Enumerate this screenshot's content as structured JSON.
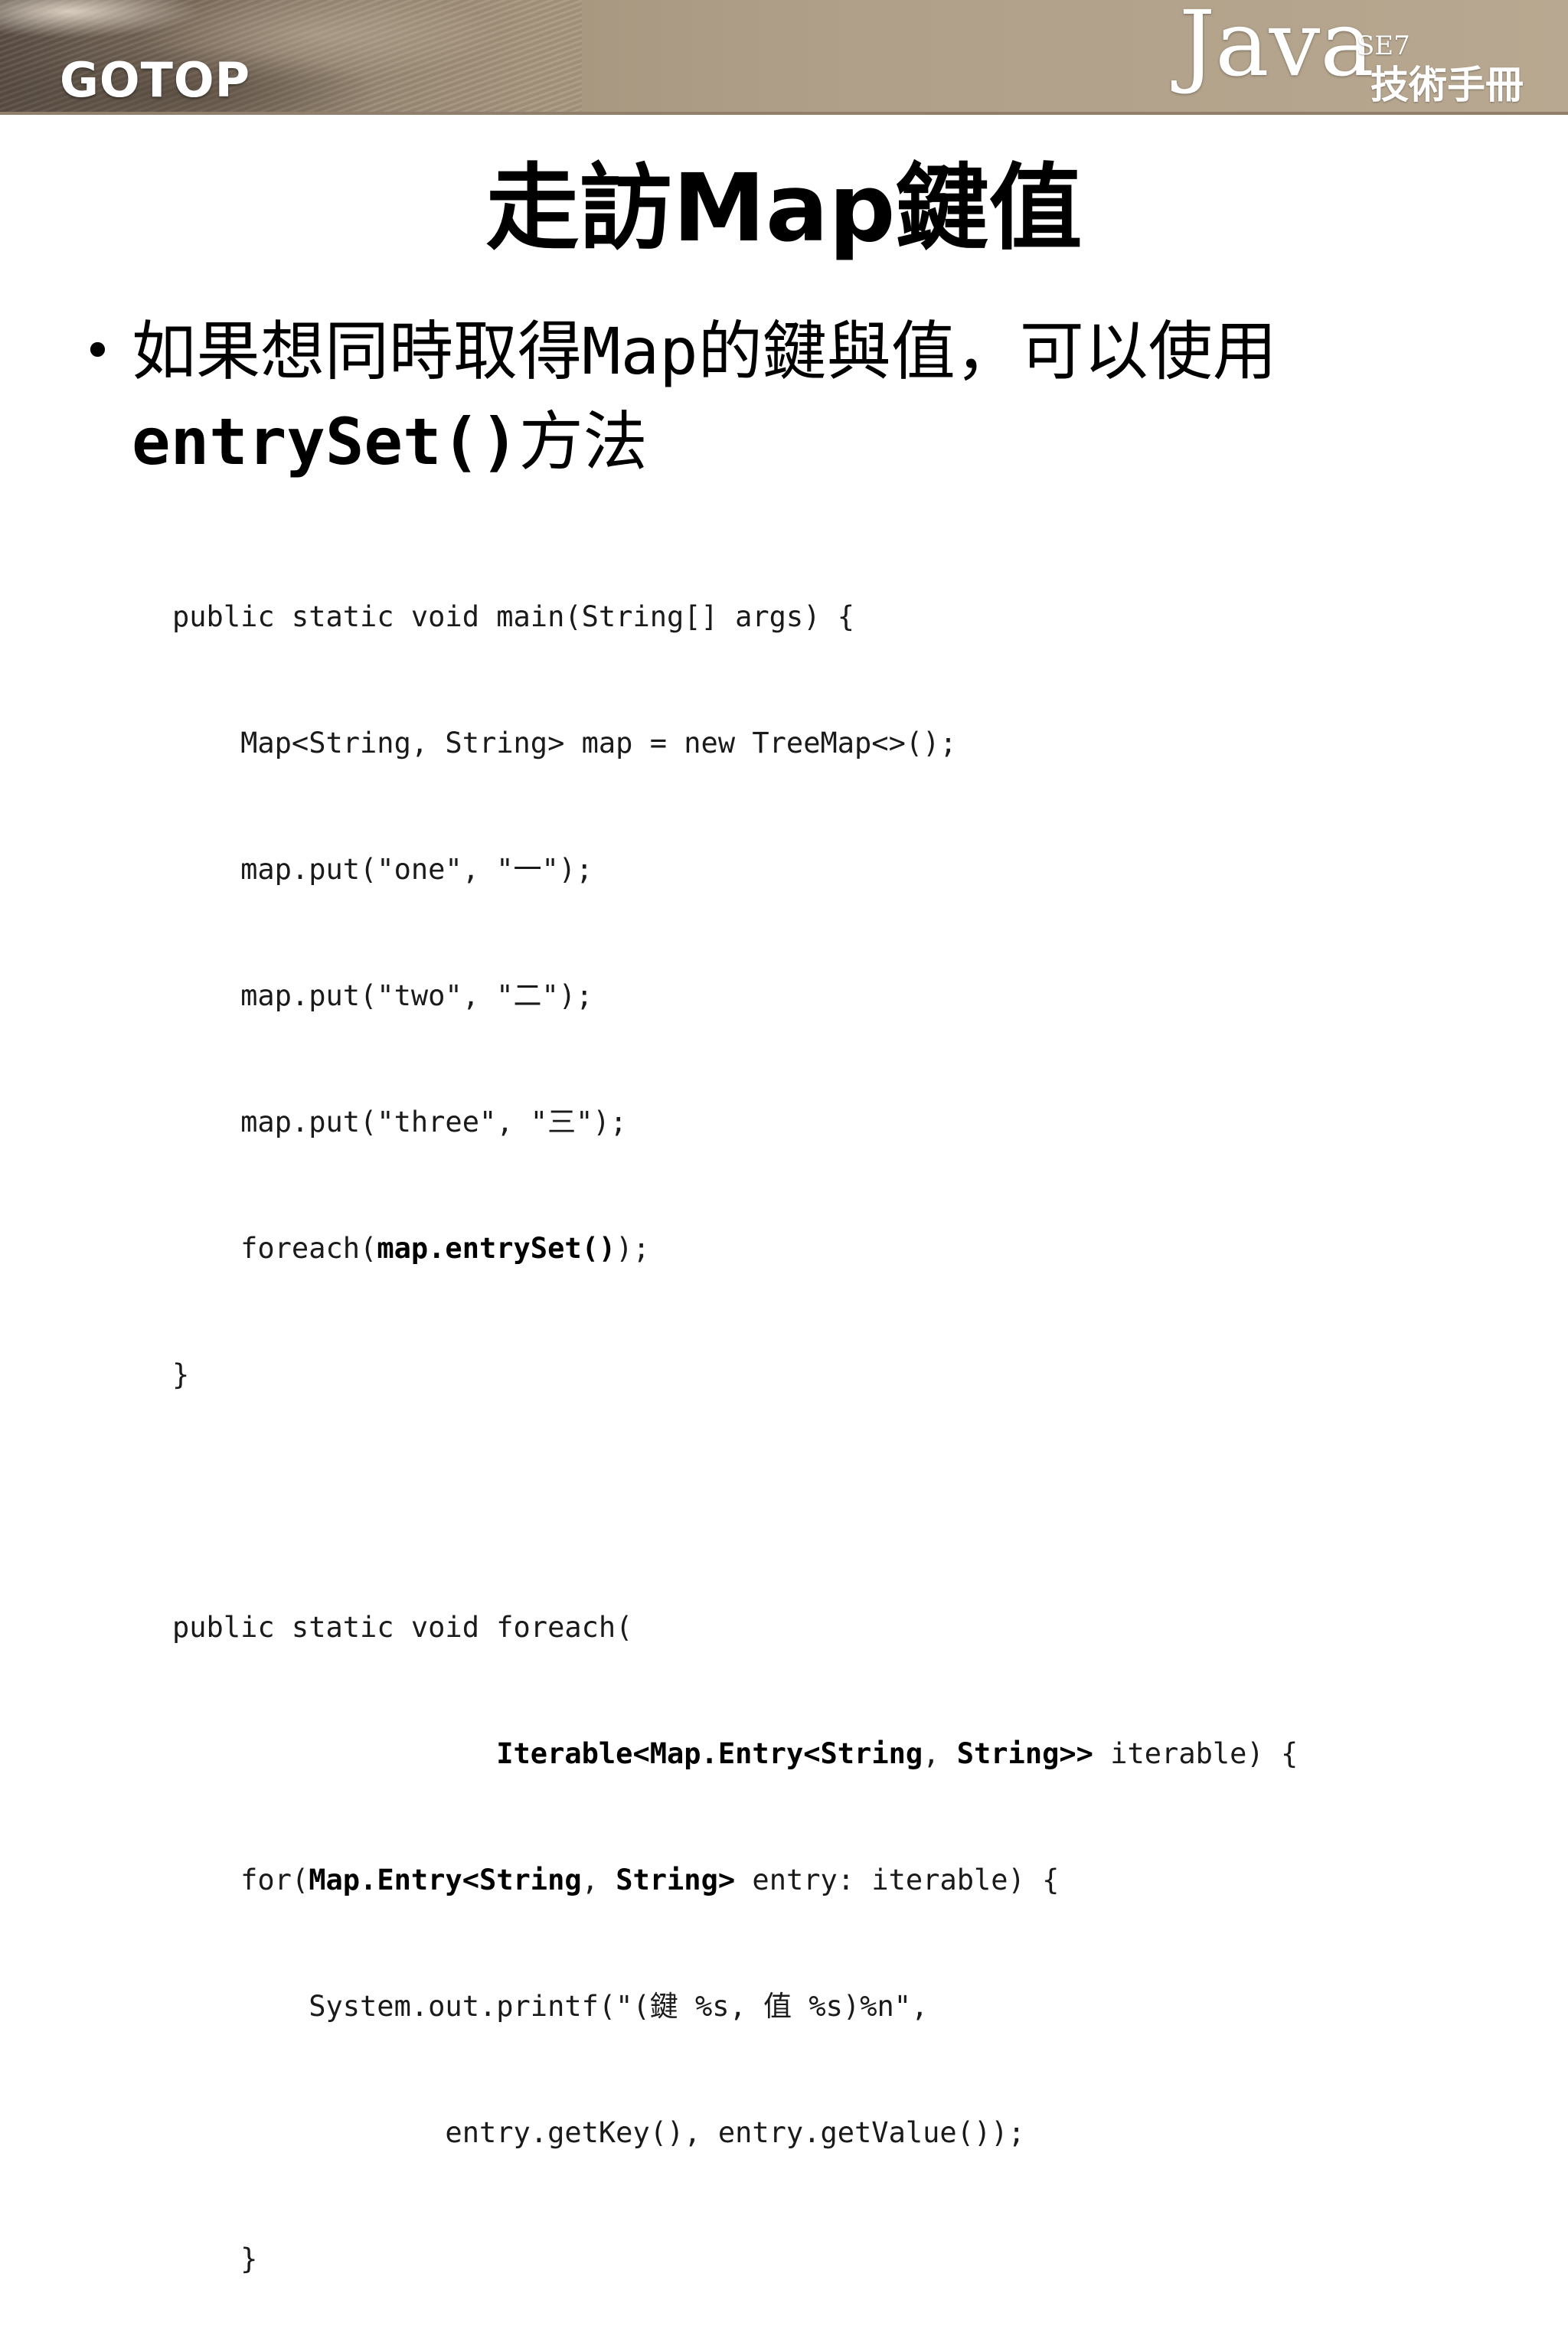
{
  "header": {
    "publisher_logo": "GOTOP",
    "book_logo": {
      "word": "Java",
      "edition": "SE7",
      "subtitle": "技術手冊"
    }
  },
  "slide": {
    "title": "走訪Map鍵值",
    "bullet": {
      "prefix": "如果想同時取得",
      "code_word": "Map",
      "middle": "的鍵與值，可以使用",
      "method": "entrySet()",
      "suffix": "方法"
    }
  },
  "code": {
    "l1": "public static void main(String[] args) {",
    "l2": "    Map<String, String> map = new TreeMap<>();",
    "l3": "    map.put(\"one\", \"一\");",
    "l4": "    map.put(\"two\", \"二\");",
    "l5": "    map.put(\"three\", \"三\");",
    "l6_pre": "    foreach(",
    "l6_bold": "map.entrySet()",
    "l6_post": ");",
    "l7": "}",
    "l8": "",
    "l9": "public static void foreach(",
    "l10_pre": "                   ",
    "l10_bold_a": "Iterable<Map.Entry<String",
    "l10_mid": ", ",
    "l10_bold_b": "String>>",
    "l10_post": " iterable) {",
    "l11_pre": "    for(",
    "l11_bold_a": "Map.Entry<String",
    "l11_mid": ", ",
    "l11_bold_b": "String>",
    "l11_post": " entry: iterable) {",
    "l12": "        System.out.printf(\"(鍵 %s, 值 %s)%n\",",
    "l13": "                entry.getKey(), entry.getValue());",
    "l14": "    }",
    "l15": "}"
  }
}
